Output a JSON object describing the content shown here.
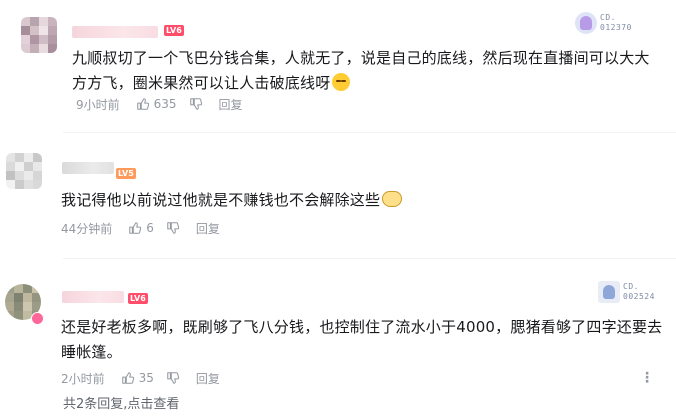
{
  "comments": [
    {
      "username_hidden": true,
      "level": "LV6",
      "text": "九顺叔切了一个飞巴分钱合集，人就无了，说是自己的底线，然后现在直播间可以大大方方飞，圈米果然可以让人击破底线呀",
      "time": "9小时前",
      "likes": "635",
      "reply": "回复",
      "badge": {
        "label": "CD.",
        "number": "012370"
      },
      "emoji": "blush-face-icon",
      "avatar_colors": [
        "#d9c9cf",
        "#b8a4ad",
        "#e6d7dc",
        "#c9b3bc",
        "#a58e99",
        "#d4c1c8",
        "#efe4e8",
        "#bda7b1",
        "#e2d2d8",
        "#ae96a2",
        "#cfbcc4",
        "#b39ca8",
        "#dccbd2",
        "#c4afb9",
        "#e9dce1",
        "#a98f9c"
      ]
    },
    {
      "username_hidden": true,
      "level": "LV5",
      "text": "我记得他以前说过他就是不赚钱也不会解除这些",
      "time": "44分钟前",
      "likes": "6",
      "reply": "回复",
      "emoji": "bowl-emoji-icon",
      "avatar_colors": [
        "#e4e4e4",
        "#d2d2d2",
        "#ececec",
        "#c8c8c8",
        "#dadada",
        "#f0f0f0",
        "#cfcfcf",
        "#e8e8e8",
        "#c2c2c2",
        "#dddddd",
        "#ebebeb",
        "#d6d6d6",
        "#f2f2f2",
        "#cbcbcb",
        "#e0e0e0",
        "#d9d9d9"
      ]
    },
    {
      "username_hidden": true,
      "level": "LV6",
      "text": "还是好老板多啊，既刷够了飞八分钱，也控制住了流水小于4000，腮猪看够了四字还要去睡帐篷。",
      "time": "2小时前",
      "likes": "35",
      "reply": "回复",
      "badge": {
        "label": "CD.",
        "number": "002524"
      },
      "avatar_colors": [
        "#9aa08a",
        "#b7b59a",
        "#8c8f7a",
        "#c9c3a9",
        "#a7a58e",
        "#7e8270",
        "#bfb89e",
        "#94957f",
        "#b0aa92",
        "#888b77",
        "#cbc6ad",
        "#9c9b85",
        "#a4a08a",
        "#8f927c",
        "#c1bba2",
        "#979884"
      ]
    }
  ],
  "footer": {
    "summary": "共2条回复,",
    "action": "点击查看"
  },
  "colors": {
    "lv5": "#ff9a5b",
    "lv6": "#ff4d6a",
    "meta": "#9499a0"
  }
}
